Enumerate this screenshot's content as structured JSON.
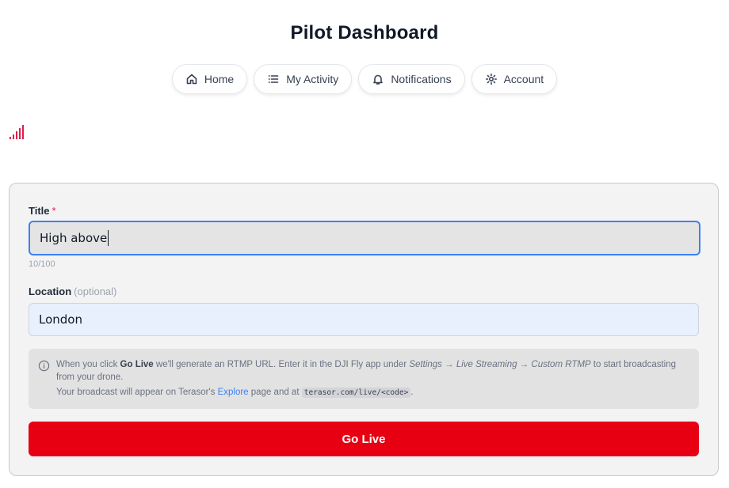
{
  "header": {
    "title": "Pilot Dashboard"
  },
  "nav": {
    "items": [
      {
        "label": "Home",
        "icon": "home-icon"
      },
      {
        "label": "My Activity",
        "icon": "list-icon"
      },
      {
        "label": "Notifications",
        "icon": "bell-icon"
      },
      {
        "label": "Account",
        "icon": "gear-icon"
      }
    ]
  },
  "signal": {
    "icon": "signal-bars-icon",
    "color": "#e11d48"
  },
  "form": {
    "title_label": "Title",
    "title_required": "*",
    "title_value": "High above",
    "title_counter": "10/100",
    "location_label": "Location",
    "location_optional": "(optional)",
    "location_value": "London",
    "info": {
      "p1_a": "When you click ",
      "p1_b": "Go Live",
      "p1_c": " we'll generate an RTMP URL. Enter it in the DJI Fly app under ",
      "p1_d": "Settings → Live Streaming → Custom RTMP",
      "p1_e": " to start broadcasting from your drone.",
      "p2_a": "Your broadcast will appear on Terasor's ",
      "p2_link": "Explore",
      "p2_b": " page and at ",
      "p2_code": "terasor.com/live/<code>",
      "p2_c": "."
    },
    "go_live_label": "Go Live",
    "accent_color": "#e60012"
  }
}
